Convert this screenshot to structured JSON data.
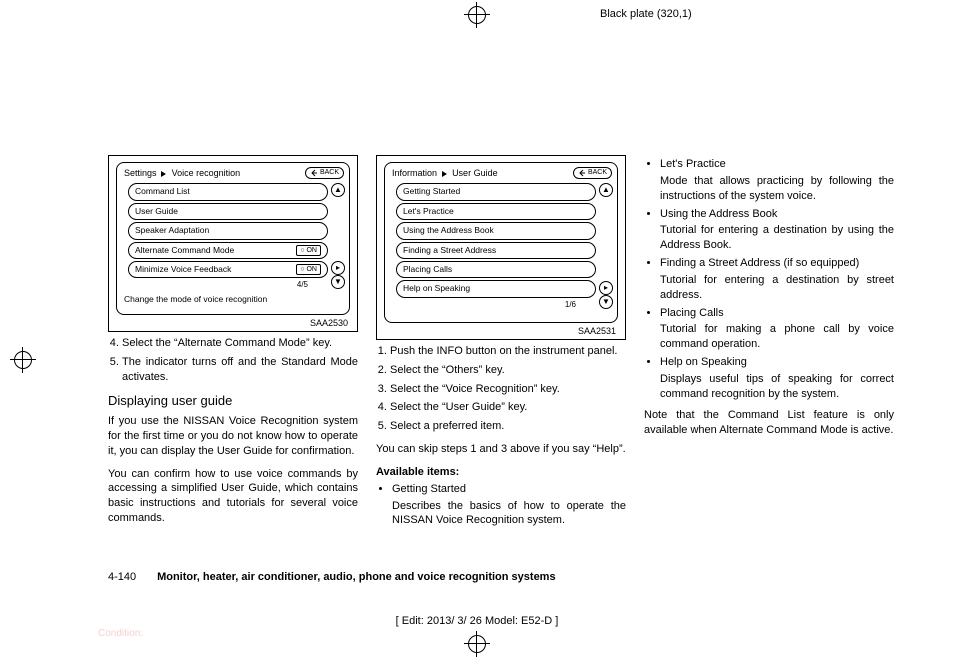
{
  "header": {
    "plate": "Black plate (320,1)"
  },
  "screen_left": {
    "breadcrumb_a": "Settings",
    "breadcrumb_b": "Voice recognition",
    "back_label": "BACK",
    "rows": [
      {
        "label": "Command List",
        "toggle": ""
      },
      {
        "label": "User Guide",
        "toggle": ""
      },
      {
        "label": "Speaker Adaptation",
        "toggle": ""
      },
      {
        "label": "Alternate Command Mode",
        "toggle": "○ ON"
      },
      {
        "label": "Minimize Voice Feedback",
        "toggle": "○ ON"
      }
    ],
    "counter": "4/5",
    "footer": "Change the mode of voice recognition",
    "fig": "SAA2530"
  },
  "screen_right": {
    "breadcrumb_a": "Information",
    "breadcrumb_b": "User Guide",
    "back_label": "BACK",
    "rows": [
      {
        "label": "Getting Started"
      },
      {
        "label": "Let's Practice"
      },
      {
        "label": "Using the Address Book"
      },
      {
        "label": "Finding a Street Address"
      },
      {
        "label": "Placing Calls"
      },
      {
        "label": "Help on Speaking"
      }
    ],
    "counter": "1/6",
    "footer": "",
    "fig": "SAA2531"
  },
  "col1": {
    "steps_a": [
      "Select the “Alternate Command Mode” key.",
      "The indicator turns off and the Standard Mode activates."
    ],
    "h2": "Displaying user guide",
    "p1": "If you use the NISSAN Voice Recognition system for the first time or you do not know how to operate it, you can display the User Guide for confirmation.",
    "p2": "You can confirm how to use voice commands by accessing a simplified User Guide, which contains basic instructions and tutorials for several voice commands."
  },
  "col2": {
    "steps": [
      "Push the INFO button on the instrument panel.",
      "Select the “Others” key.",
      "Select the “Voice Recognition” key.",
      "Select the “User Guide” key.",
      "Select a preferred item."
    ],
    "skip": "You can skip steps 1 and 3 above if you say “Help”.",
    "avail_h": "Available items:",
    "first_item": "Getting Started",
    "first_desc": "Describes the basics of how to operate the NISSAN Voice Recognition system."
  },
  "col3": {
    "items": [
      {
        "t": "Let's Practice",
        "d": "Mode that allows practicing by following the instructions of the system voice."
      },
      {
        "t": "Using the Address Book",
        "d": "Tutorial for entering a destination by using the Address Book."
      },
      {
        "t": "Finding a Street Address (if so equipped)",
        "d": "Tutorial for entering a destination by street address."
      },
      {
        "t": "Placing Calls",
        "d": "Tutorial for making a phone call by voice command operation."
      },
      {
        "t": "Help on Speaking",
        "d": "Displays useful tips of speaking for correct command recognition by the system."
      }
    ],
    "note": "Note that the Command List feature is only available when Alternate Command Mode is active."
  },
  "footer": {
    "page": "4-140",
    "title": "Monitor, heater, air conditioner, audio, phone and voice recognition systems",
    "edit": "[ Edit: 2013/ 3/ 26  Model: E52-D ]",
    "condition": "Condition:"
  }
}
